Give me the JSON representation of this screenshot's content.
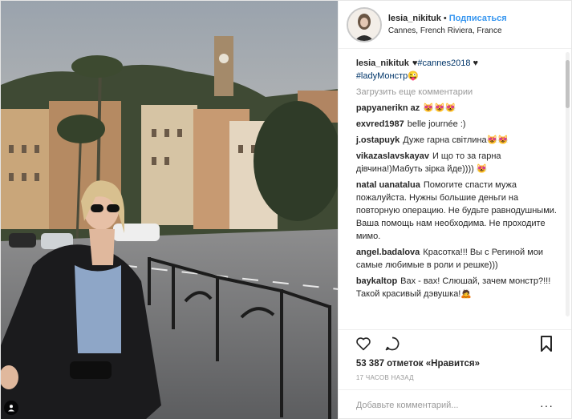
{
  "header": {
    "username": "lesia_nikituk",
    "separator": "•",
    "follow_label": "Подписаться",
    "location": "Cannes, French Riviera, France"
  },
  "caption": {
    "username": "lesia_nikituk",
    "text_a": "♥",
    "tag1": "#cannes2018",
    "text_b": "♥",
    "tag2": "#ladyМонстр",
    "emoji": "😜"
  },
  "load_more": "Загрузить еще комментарии",
  "comments": [
    {
      "user": "papyanerikn az",
      "text": "😻😻😻"
    },
    {
      "user": "exvred1987",
      "text": "belle journée :)"
    },
    {
      "user": "j.ostapuyk",
      "text": "Дуже гарна свiтлина😻😻"
    },
    {
      "user": "vikazaslavskayav",
      "text": "И що то за гарна дiвчина!)Мабуть зiрка йде)))) 😻"
    },
    {
      "user": "natal uanatalua",
      "text": "Помогите спасти мужа пожалуйста. Нужны большие деньги на повторную операцию. Не будьте равнодушными. Ваша помощь нам необходима. Не проходите мимо."
    },
    {
      "user": "angel.badalova",
      "text": "Красотка!!! Вы с Региной мои самые любимые в роли и решке)))"
    },
    {
      "user": "baykaltop",
      "text": "Вах - вах! Слюшай, зачем монстр?!!! Такой красивый дэвушка!🙇"
    }
  ],
  "likes": "53 387 отметок «Нравится»",
  "time_ago": "17 ЧАСОВ НАЗАД",
  "add_comment_placeholder": "Добавьте комментарий...",
  "more_label": "···",
  "colors": {
    "link": "#3897f0",
    "hashtag": "#003569",
    "muted": "#999999"
  }
}
